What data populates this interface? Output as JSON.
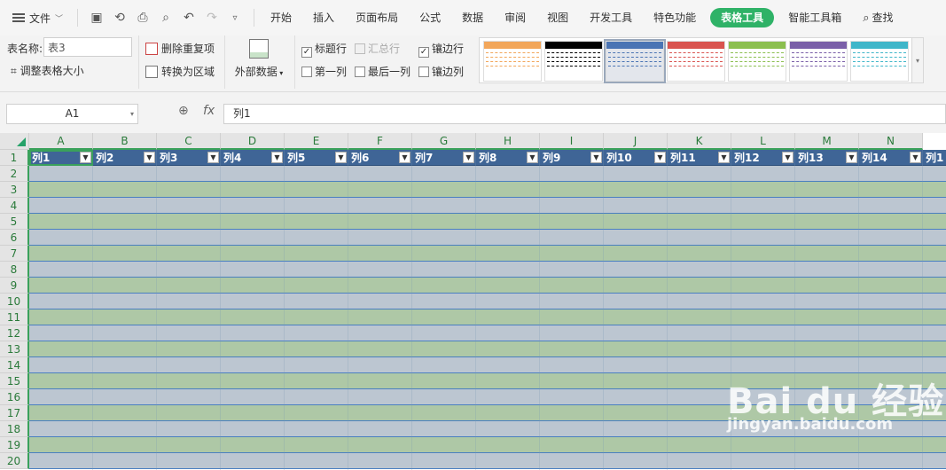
{
  "menu": {
    "file_label": "文件",
    "tabs": [
      "开始",
      "插入",
      "页面布局",
      "公式",
      "数据",
      "审阅",
      "视图",
      "开发工具",
      "特色功能",
      "表格工具",
      "智能工具箱",
      "查找"
    ],
    "active_tab_index": 9
  },
  "ribbon": {
    "table_name_label": "表名称:",
    "table_name_value": "表3",
    "resize_label": "调整表格大小",
    "remove_dup_label": "删除重复项",
    "convert_label": "转换为区域",
    "external_data_label": "外部数据",
    "options": {
      "header_row": {
        "label": "标题行",
        "checked": true
      },
      "total_row": {
        "label": "汇总行",
        "checked": false,
        "disabled": true
      },
      "banded_rows": {
        "label": "镶边行",
        "checked": true
      },
      "first_col": {
        "label": "第一列",
        "checked": false
      },
      "last_col": {
        "label": "最后一列",
        "checked": false
      },
      "banded_cols": {
        "label": "镶边列",
        "checked": false
      }
    },
    "style_colors": [
      "#f2a65a",
      "#000000",
      "#4a74b4",
      "#d9534f",
      "#8bbf4f",
      "#7a5fa8",
      "#3fb6c9"
    ],
    "selected_style_index": 2
  },
  "formula_bar": {
    "name_box": "A1",
    "fx": "fx",
    "content": "列1"
  },
  "sheet": {
    "columns": [
      "A",
      "B",
      "C",
      "D",
      "E",
      "F",
      "G",
      "H",
      "I",
      "J",
      "K",
      "L",
      "M",
      "N"
    ],
    "header_cells": [
      "列1",
      "列2",
      "列3",
      "列4",
      "列5",
      "列6",
      "列7",
      "列8",
      "列9",
      "列10",
      "列11",
      "列12",
      "列13",
      "列14",
      "列1"
    ],
    "row_numbers": [
      "1",
      "2",
      "3",
      "4",
      "5",
      "6",
      "7",
      "8",
      "9",
      "10",
      "11",
      "12",
      "13",
      "14",
      "15",
      "16",
      "17",
      "18",
      "19",
      "20"
    ],
    "header_bg": "#3f6596",
    "band_colors": [
      "#bcc6d1",
      "#aec8a6"
    ]
  },
  "watermark": {
    "main": "Bai du 经验",
    "url": "jingyan.baidu.com"
  }
}
